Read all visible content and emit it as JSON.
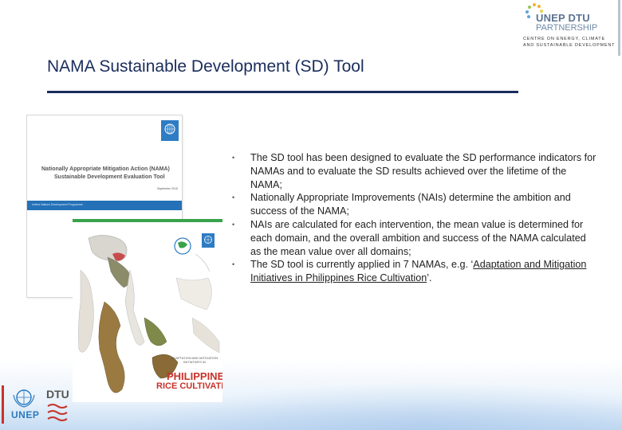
{
  "header": {
    "logo_title": "UNEP DTU",
    "logo_subtitle": "PARTNERSHIP",
    "logo_line1": "CENTRE ON ENERGY, CLIMATE",
    "logo_line2": "AND SUSTAINABLE DEVELOPMENT"
  },
  "slide": {
    "title": "NAMA Sustainable Development (SD) Tool"
  },
  "cover1": {
    "title_line1": "Nationally Appropriate Mitigation Action (NAMA)",
    "title_line2": "Sustainable Development Evaluation Tool",
    "date": "September 2015",
    "band_text": "United Nations Development Programme"
  },
  "cover2": {
    "subtitle": "ADAPTATION AND MITIGATION INITIATIVES IN",
    "big_line1": "PHILIPPINE",
    "big_line2": "RICE CULTIVATION"
  },
  "bullets": [
    {
      "text": "The SD tool has been designed to evaluate the SD performance indicators for NAMAs and to evaluate the SD results achieved over the lifetime of the NAMA;"
    },
    {
      "text": "Nationally Appropriate Improvements (NAIs) determine the ambition and success of the NAMA;"
    },
    {
      "text": "NAIs are calculated for each intervention, the mean value is determined for each domain, and the overall ambition and success of the NAMA calculated as the mean value over all domains;"
    },
    {
      "prefix": "The SD tool is currently applied in 7 NAMAs, e.g. ‘",
      "link": "Adaptation and Mitigation Initiatives in Philippines Rice Cultivation",
      "suffix": "’."
    }
  ],
  "bullet_symbol": "•",
  "footer_logos": {
    "unep": "UNEP",
    "dtu": "DTU"
  },
  "colors": {
    "title": "#1a2d5c",
    "un_blue": "#2e7cc4",
    "red_accent": "#c8322a",
    "green_accent": "#39a24a"
  }
}
